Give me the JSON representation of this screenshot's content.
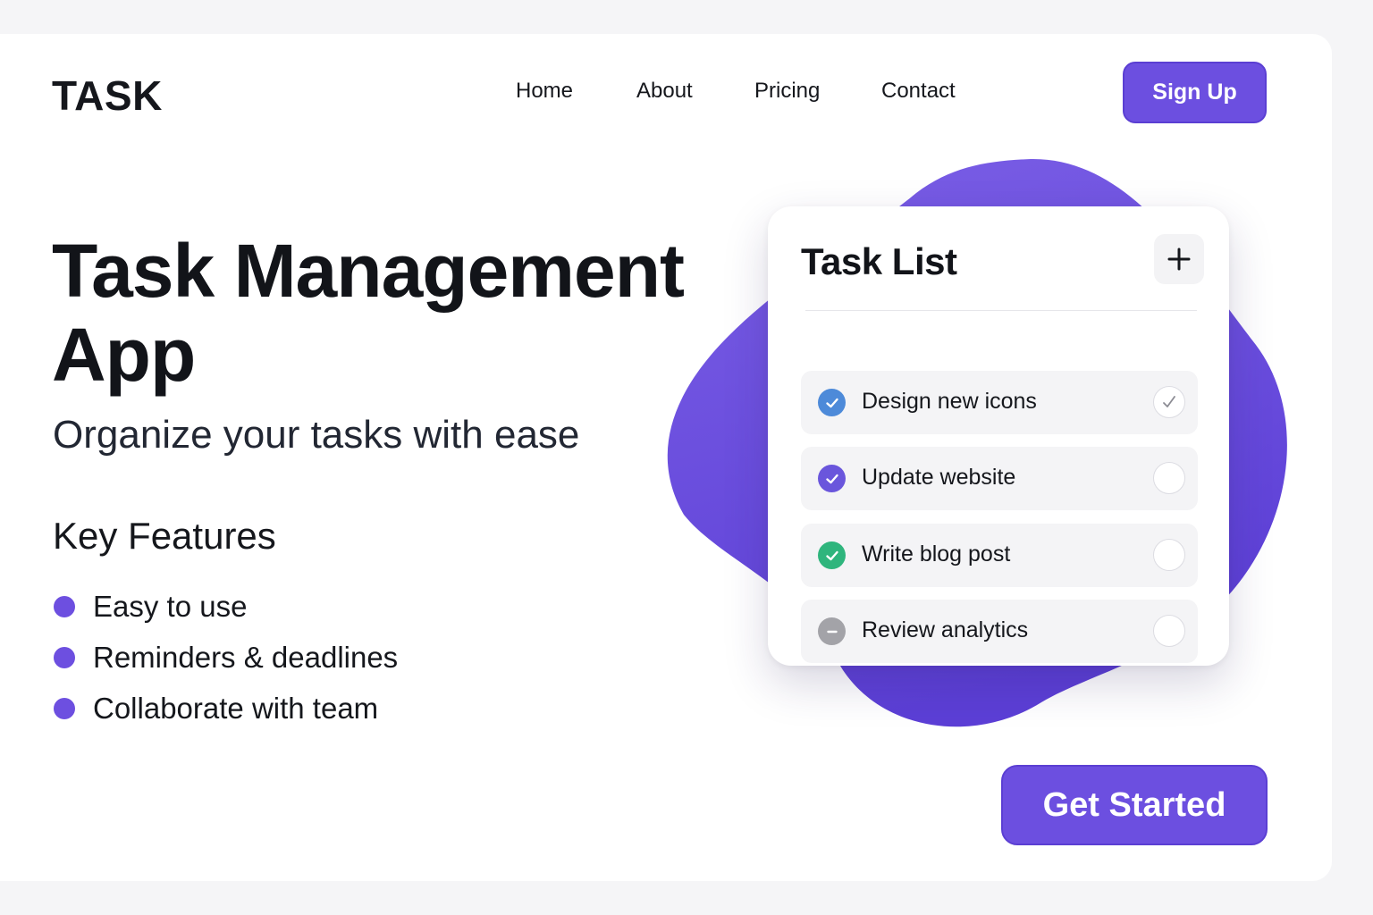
{
  "brand": {
    "logo_text": "TASK",
    "accent": "#6c4fe0"
  },
  "nav": {
    "links": [
      {
        "label": "Home"
      },
      {
        "label": "About"
      },
      {
        "label": "Pricing"
      },
      {
        "label": "Contact"
      }
    ],
    "signup_label": "Sign Up"
  },
  "hero": {
    "title": "Task Management App",
    "subtitle": "Organize your tasks with ease",
    "features_title": "Key Features",
    "features": [
      {
        "label": "Easy to use"
      },
      {
        "label": "Reminders & deadlines"
      },
      {
        "label": "Collaborate with team"
      }
    ],
    "cta_label": "Get Started"
  },
  "task_card": {
    "title": "Task List",
    "add_icon": "plus-icon",
    "tasks": [
      {
        "label": "Design new icons",
        "status_icon": "check-circle-icon",
        "status_color": "#4d8ad9",
        "checked": true
      },
      {
        "label": "Update website",
        "status_icon": "check-circle-icon",
        "status_color": "#6a56dc",
        "checked": false
      },
      {
        "label": "Write blog post",
        "status_icon": "check-circle-icon",
        "status_color": "#2fb57d",
        "checked": false
      },
      {
        "label": "Review analytics",
        "status_icon": "minus-circle-icon",
        "status_color": "#a3a3a8",
        "checked": false
      }
    ]
  }
}
